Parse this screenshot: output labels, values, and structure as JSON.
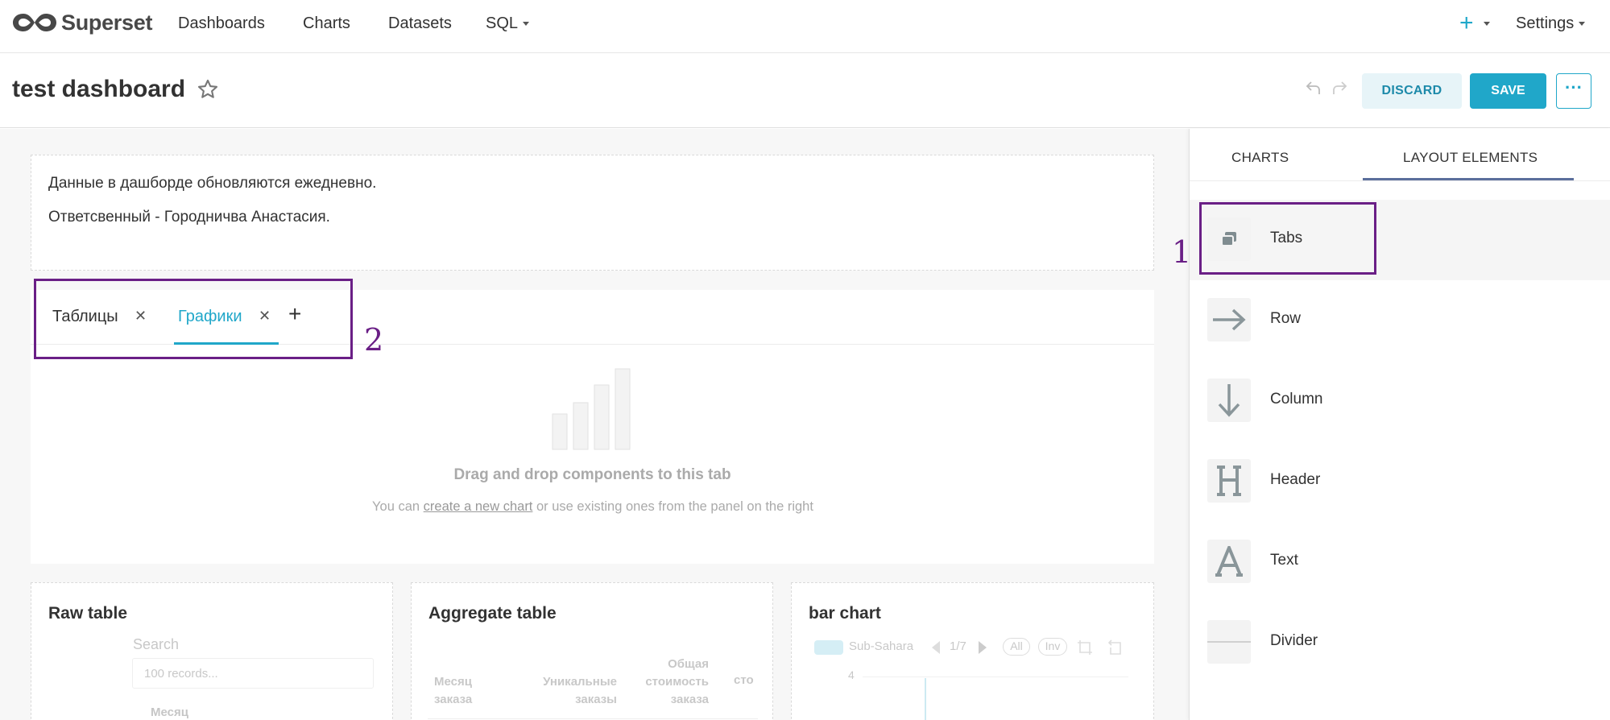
{
  "nav": {
    "brand": "Superset",
    "links": [
      "Dashboards",
      "Charts",
      "Datasets",
      "SQL"
    ],
    "plus": "+",
    "settings": "Settings"
  },
  "header": {
    "title": "test dashboard",
    "discard": "DISCARD",
    "save": "SAVE",
    "more": "···"
  },
  "markdown": {
    "lines": [
      "Данные в дашборде обновляются ежедневно.",
      "Ответсвенный - Городничва Анастасия."
    ]
  },
  "tabs": {
    "items": [
      "Таблицы",
      "Графики"
    ],
    "close": "✕",
    "add": "+",
    "empty_title": "Drag and drop components to this tab",
    "empty_prefix": "You can ",
    "empty_link": "create a new chart",
    "empty_suffix": " or use existing ones from the panel on the right"
  },
  "cards": {
    "raw": {
      "title": "Raw table",
      "search": "Search",
      "placeholder": "100 records...",
      "col": "Месяц"
    },
    "agg": {
      "title": "Aggregate table",
      "cols": [
        "Месяц заказа",
        "Уникальные заказы",
        "Общая стоимость заказа",
        "сто"
      ]
    },
    "bar": {
      "title": "bar chart",
      "legend": "Sub-Sahara",
      "page": "1/7",
      "all": "All",
      "inv": "Inv",
      "tick": "4"
    }
  },
  "panel": {
    "tabs": [
      "CHARTS",
      "LAYOUT ELEMENTS"
    ],
    "items": [
      "Tabs",
      "Row",
      "Column",
      "Header",
      "Text",
      "Divider"
    ]
  },
  "annotations": [
    "1",
    "2"
  ],
  "colors": {
    "accent": "#20a7c9",
    "annotation": "#6a1f86",
    "indicator": "#5b6f9c"
  }
}
